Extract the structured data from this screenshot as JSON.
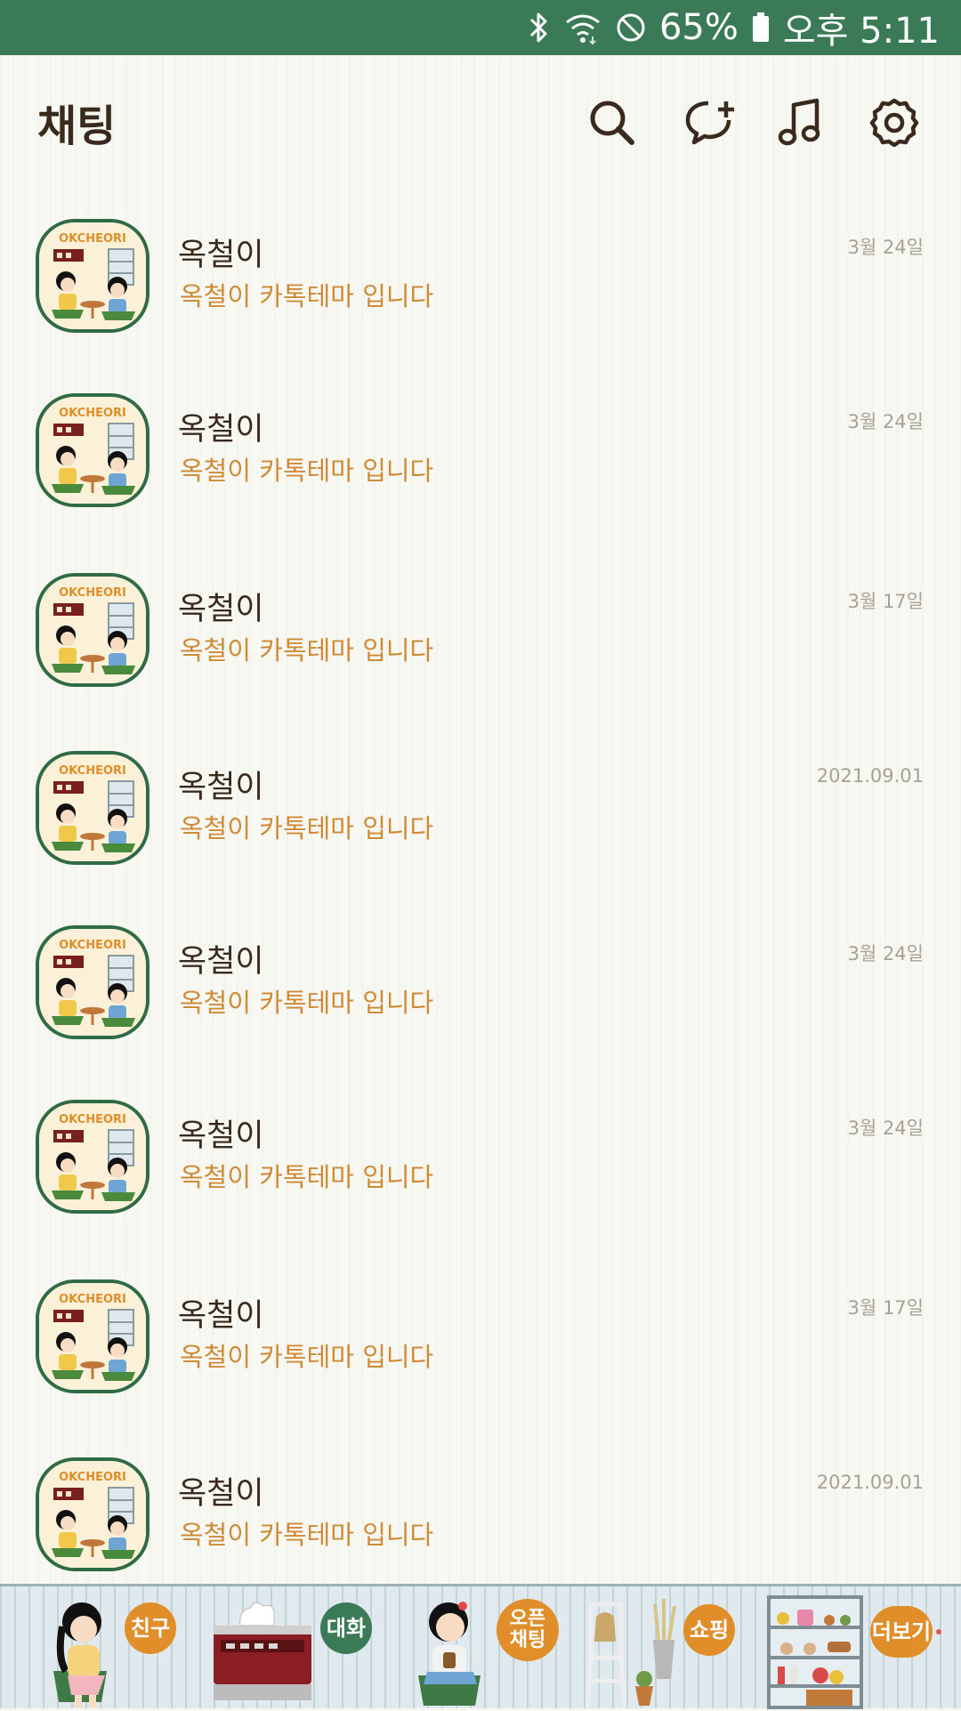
{
  "status_bar": {
    "battery": "65%",
    "time": "오후 5:11",
    "icons": [
      "bluetooth-icon",
      "wifi-icon",
      "do-not-disturb-icon",
      "battery-icon"
    ]
  },
  "header": {
    "title": "채팅",
    "icons": [
      "search-icon",
      "new-chat-icon",
      "music-icon",
      "settings-icon"
    ]
  },
  "chats": [
    {
      "name": "옥철이",
      "preview": "옥철이 카톡테마 입니다",
      "date": "3월 24일"
    },
    {
      "name": "옥철이",
      "preview": "옥철이 카톡테마 입니다",
      "date": "3월 24일"
    },
    {
      "name": "옥철이",
      "preview": "옥철이 카톡테마 입니다",
      "date": "3월 17일"
    },
    {
      "name": "옥철이",
      "preview": "옥철이 카톡테마 입니다",
      "date": "2021.09.01"
    },
    {
      "name": "옥철이",
      "preview": "옥철이 카톡테마 입니다",
      "date": "3월 24일"
    },
    {
      "name": "옥철이",
      "preview": "옥철이 카톡테마 입니다",
      "date": "3월 24일"
    },
    {
      "name": "옥철이",
      "preview": "옥철이 카톡테마 입니다",
      "date": "3월 17일"
    },
    {
      "name": "옥철이",
      "preview": "옥철이 카톡테마 입니다",
      "date": "2021.09.01"
    }
  ],
  "avatar_text": "OKCHEORI",
  "bottom_nav": {
    "friends": "친구",
    "chats": "대화",
    "open_chat_line1": "오픈",
    "open_chat_line2": "채팅",
    "shopping": "쇼핑",
    "more": "더보기"
  },
  "colors": {
    "status_bar": "#3a7a57",
    "accent_orange": "#e08e2a",
    "preview_text": "#cf8a36",
    "title_text": "#3a2a1e"
  }
}
